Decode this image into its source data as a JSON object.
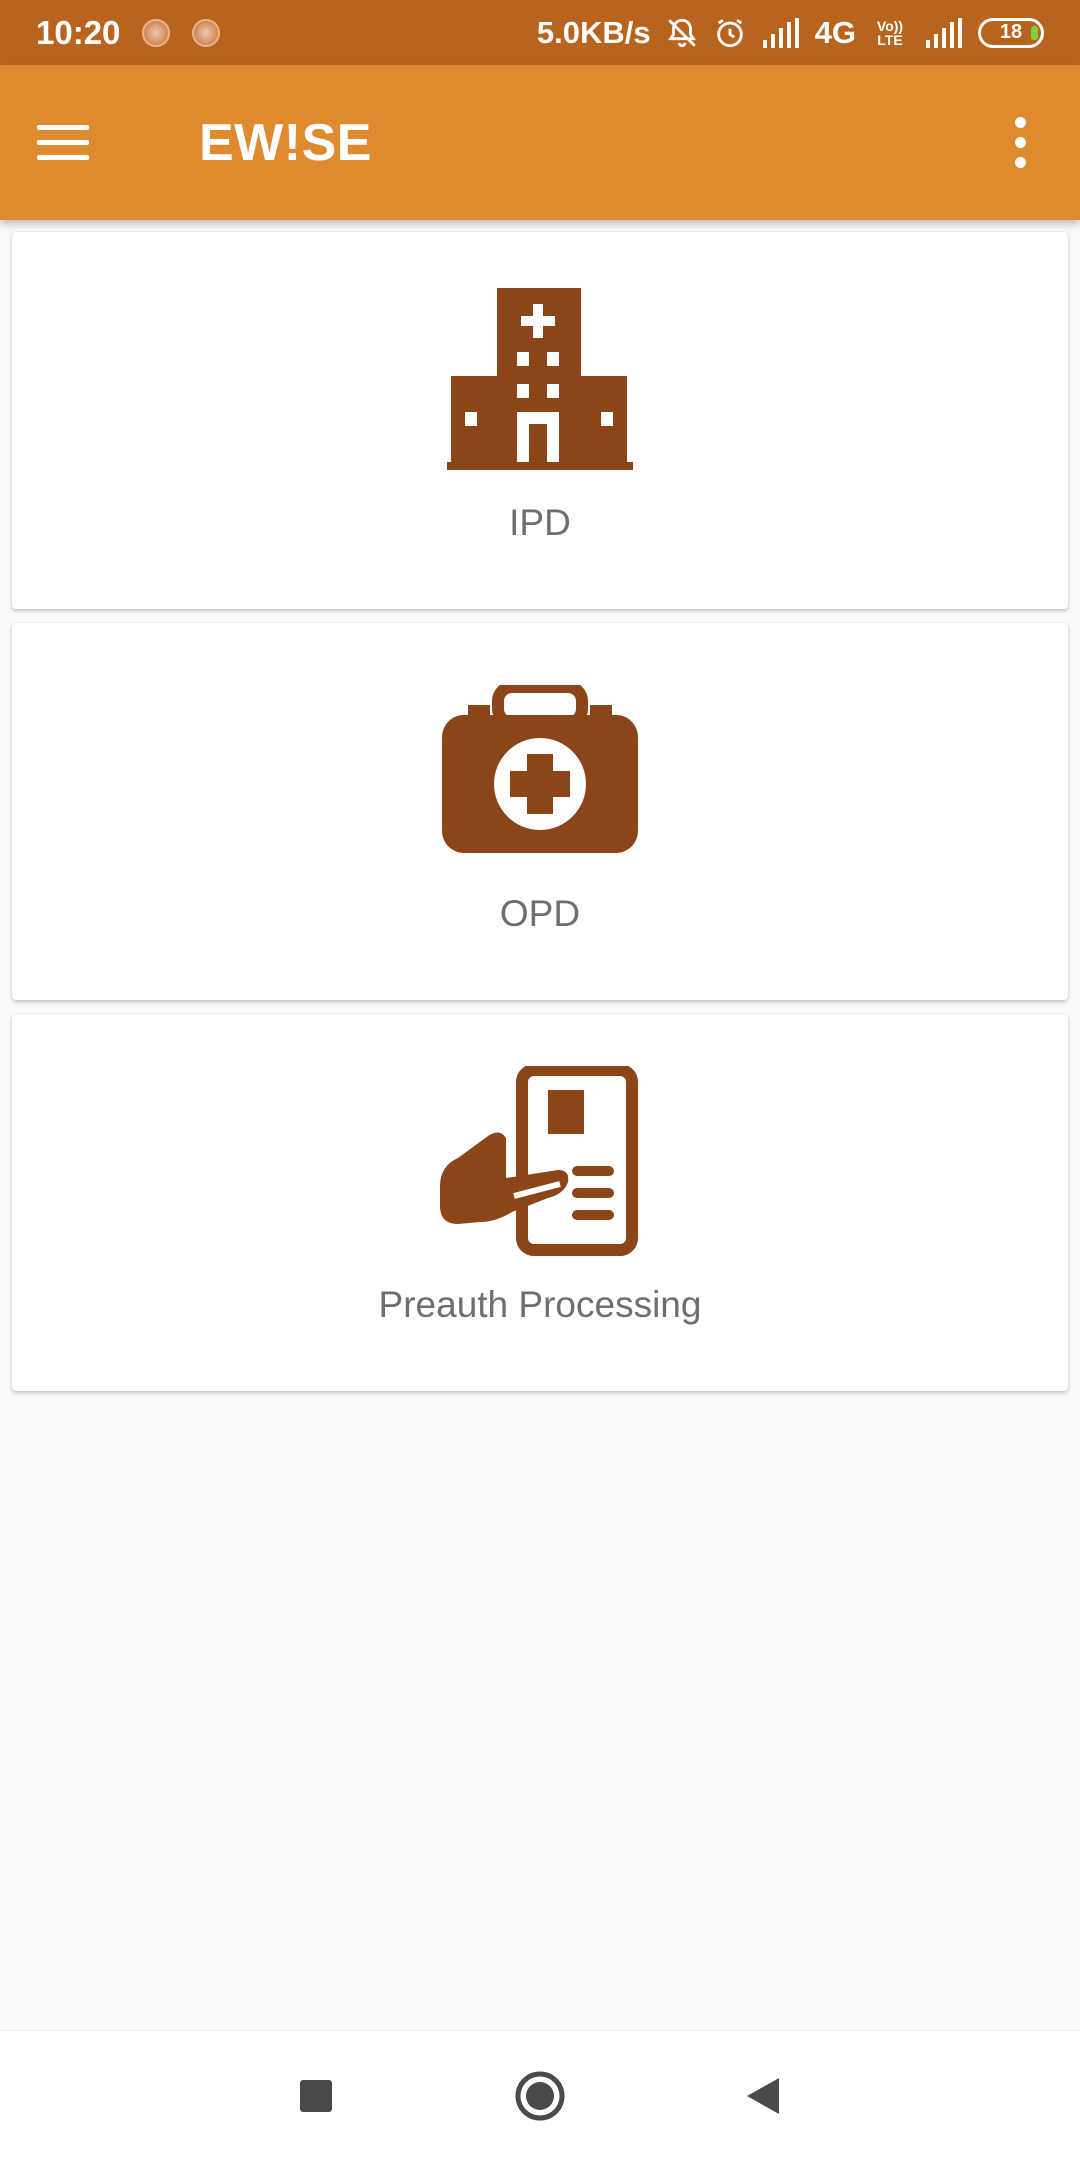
{
  "status_bar": {
    "time": "10:20",
    "net_speed": "5.0KB/s",
    "network": "4G",
    "lte_label": "Vo)) LTE",
    "battery": "18"
  },
  "app_bar": {
    "title": "EW!SE",
    "menu_icon": "hamburger-menu-icon",
    "overflow_icon": "more-vert-icon"
  },
  "cards": [
    {
      "label": "IPD",
      "icon": "hospital-building-icon"
    },
    {
      "label": "OPD",
      "icon": "medical-kit-icon"
    },
    {
      "label": "Preauth Processing",
      "icon": "hand-document-icon"
    }
  ],
  "nav_bar": {
    "recent_icon": "square-recent-icon",
    "home_icon": "circle-home-icon",
    "back_icon": "triangle-back-icon"
  },
  "colors": {
    "status_bar": "#b8641f",
    "app_bar": "#de8a2f",
    "icon": "#8b4518",
    "label": "#6e6e6e",
    "background": "#fafafa"
  }
}
